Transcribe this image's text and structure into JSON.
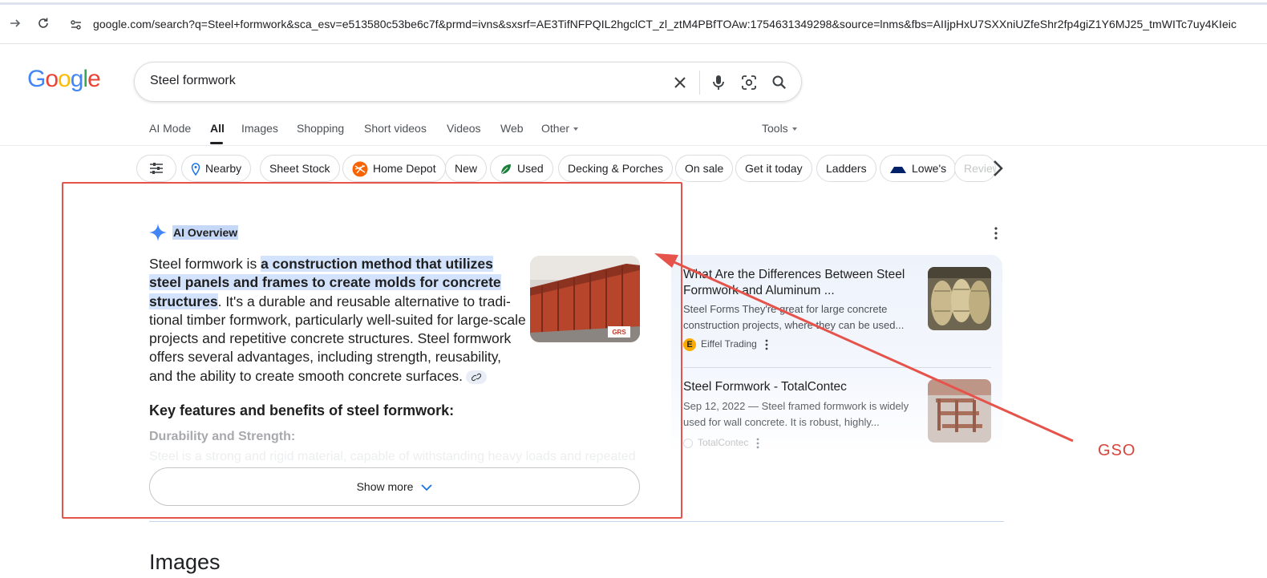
{
  "browser": {
    "url": "google.com/search?q=Steel+formwork&sca_esv=e513580c53be6c7f&prmd=ivns&sxsrf=AE3TifNFPQIL2hgclCT_zl_ztM4PBfTOAw:1754631349298&source=lnms&fbs=AIIjpHxU7SXXniUZfeShr2fp4giZ1Y6MJ25_tmWITc7uy4KIeic"
  },
  "logo": {
    "letters": [
      "G",
      "o",
      "o",
      "g",
      "l",
      "e"
    ]
  },
  "search": {
    "query": "Steel formwork"
  },
  "tabs": {
    "items": [
      "AI Mode",
      "All",
      "Images",
      "Shopping",
      "Short videos",
      "Videos",
      "Web",
      "Other"
    ],
    "active": "All",
    "tools": "Tools"
  },
  "chips": [
    "Nearby",
    "Sheet Stock",
    "Home Depot",
    "New",
    "Used",
    "Decking & Porches",
    "On sale",
    "Get it today",
    "Ladders",
    "Lowe's",
    "Reviews"
  ],
  "ai_overview": {
    "label": "AI Overview",
    "intro": "Steel formwork is ",
    "highlight": "a construction method that utilizes steel panels and frames to create molds for concrete structures",
    "body": ". It's a durable and reusable alternative to tradi-tional timber formwork, particularly well-suited for large-scale projects and repetitive concrete structures. Steel formwork offers several advantages, including strength, reusability, and the ability to create smooth concrete surfaces.",
    "subheading": "Key features and benefits of steel formwork:",
    "sub2": "Durability and Strength:",
    "faded": "Steel is a strong and rigid material, capable of withstanding heavy loads and repeated",
    "show_more": "Show more",
    "thumb_badge": "GRS"
  },
  "sources": [
    {
      "title": "What Are the Differences Between Steel Formwork and Aluminum ...",
      "snippet": "Steel Forms They're great for large concrete construction projects, where they can be used...",
      "site": "Eiffel Trading",
      "favicon_letter": "E"
    },
    {
      "title": "Steel Formwork - TotalContec",
      "snippet": "Sep 12, 2022 — Steel framed formwork is widely used for wall concrete. It is robust, highly...",
      "site": "TotalContec",
      "favicon_letter": ""
    }
  ],
  "annotation": {
    "label": "GSO",
    "color": "#d6453c"
  },
  "images_heading": "Images",
  "colors": {
    "highlight": "#d3e3fd",
    "annotation_red": "#e5534b",
    "google_blue": "#4285f4"
  }
}
